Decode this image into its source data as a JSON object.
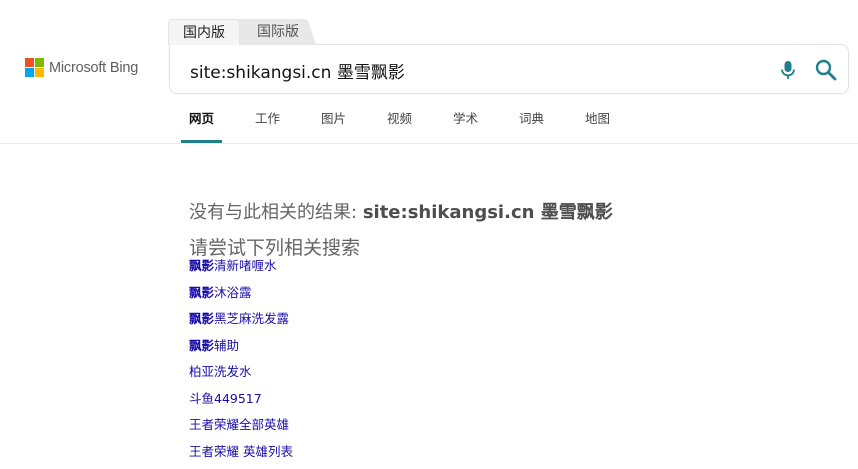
{
  "brand": {
    "name": "Microsoft Bing",
    "logo_colors": [
      "#f25022",
      "#7fba00",
      "#00a4ef",
      "#ffb900"
    ]
  },
  "region_tabs": [
    {
      "label": "国内版",
      "active": true
    },
    {
      "label": "国际版",
      "active": false
    }
  ],
  "search": {
    "query": "site:shikangsi.cn 墨雪飘影",
    "mic_icon": "microphone-icon",
    "search_icon": "magnifier-icon",
    "accent": "#1f7f8a"
  },
  "nav": [
    {
      "label": "网页",
      "active": true
    },
    {
      "label": "工作"
    },
    {
      "label": "图片"
    },
    {
      "label": "视频"
    },
    {
      "label": "学术"
    },
    {
      "label": "词典"
    },
    {
      "label": "地图"
    }
  ],
  "results": {
    "no_result_prefix": "没有与此相关的结果:",
    "no_result_query": "site:shikangsi.cn 墨雪飘影",
    "try_title": "请尝试下列相关搜索",
    "suggestions": [
      {
        "bold": "飘影",
        "rest": "清新啫喱水"
      },
      {
        "bold": "飘影",
        "rest": "沐浴露"
      },
      {
        "bold": "飘影",
        "rest": "黑芝麻洗发露"
      },
      {
        "bold": "飘影",
        "rest": "辅助"
      },
      {
        "bold": "",
        "rest": "柏亚洗发水"
      },
      {
        "bold": "",
        "rest": "斗鱼449517"
      },
      {
        "bold": "",
        "rest": "王者荣耀全部英雄"
      },
      {
        "bold": "",
        "rest": "王者荣耀 英雄列表"
      }
    ],
    "link_color": "#1a0dab"
  }
}
